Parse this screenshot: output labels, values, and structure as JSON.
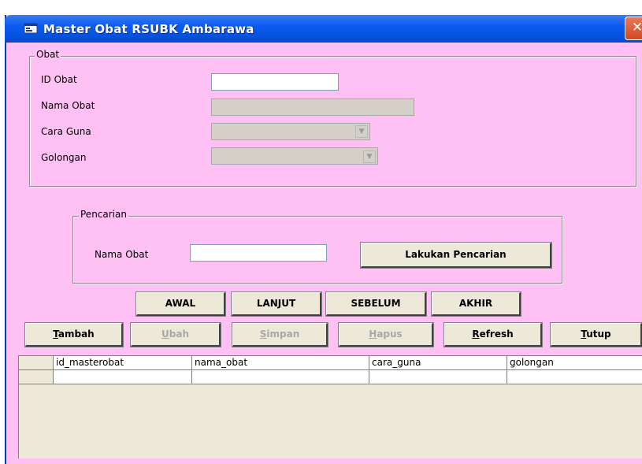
{
  "window": {
    "title": "Master Obat RSUBK Ambarawa",
    "close_glyph": "✕"
  },
  "obat_group": {
    "legend": "Obat",
    "id_label": "ID Obat",
    "nama_label": "Nama Obat",
    "cara_label": "Cara Guna",
    "golongan_label": "Golongan",
    "id_value": "",
    "nama_value": ""
  },
  "search_group": {
    "legend": "Pencarian",
    "nama_label": "Nama Obat",
    "value": "",
    "search_button": "Lakukan Pencarian"
  },
  "nav": {
    "first": "AWAL",
    "next": "LANJUT",
    "prev": "SEBELUM",
    "last": "AKHIR"
  },
  "actions": {
    "add": {
      "hotkey": "T",
      "rest": "ambah"
    },
    "edit": {
      "hotkey": "U",
      "rest": "bah"
    },
    "save": {
      "hotkey": "S",
      "rest": "impan"
    },
    "delete": {
      "hotkey": "H",
      "rest": "apus"
    },
    "refresh": {
      "hotkey": "R",
      "rest": "efresh"
    },
    "close": {
      "hotkey": "T",
      "rest": "utup"
    }
  },
  "grid": {
    "columns": [
      "id_masterobat",
      "nama_obat",
      "cara_guna",
      "golongan"
    ]
  },
  "colors": {
    "form_bg": "#ffc0f4",
    "titlebar": "#0a5bef",
    "disabled": "#d4d0c8"
  }
}
